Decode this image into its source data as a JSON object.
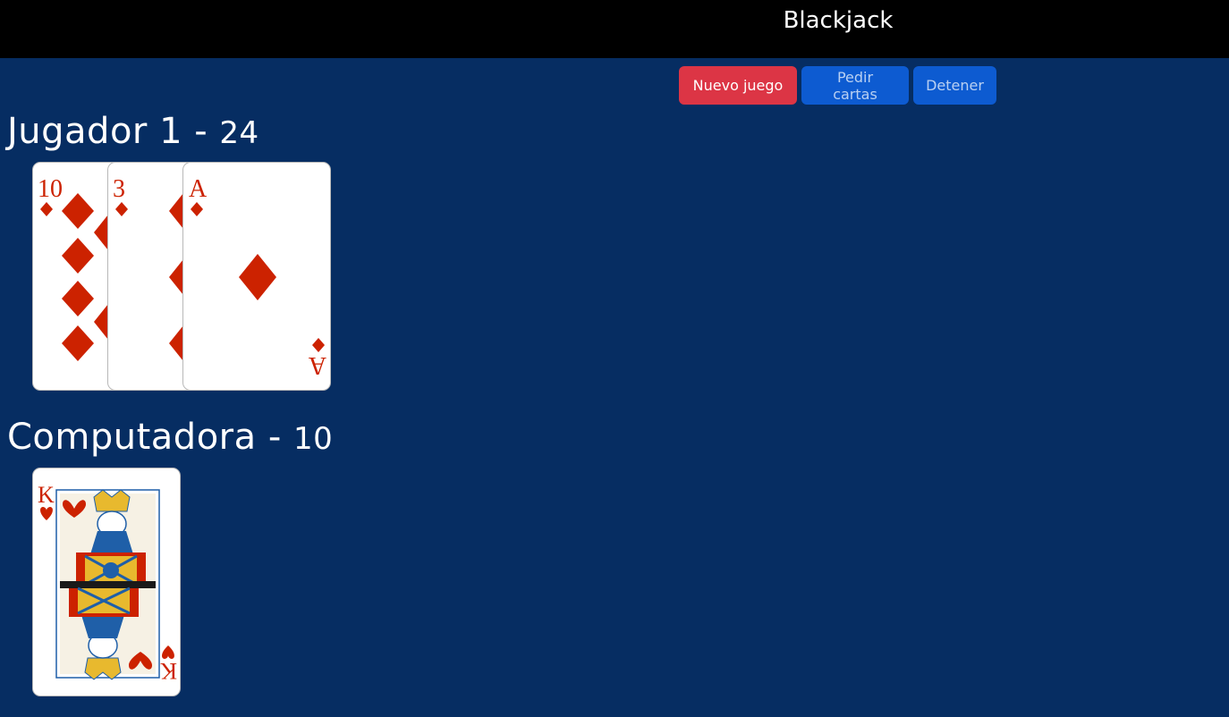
{
  "header": {
    "title": "Blackjack"
  },
  "controls": {
    "new_game": "Nuevo juego",
    "hit": "Pedir cartas",
    "stand": "Detener"
  },
  "player": {
    "name": "Jugador 1",
    "separator": "-",
    "score": "24",
    "cards": [
      {
        "rank": "10",
        "suit": "diamonds"
      },
      {
        "rank": "3",
        "suit": "diamonds"
      },
      {
        "rank": "A",
        "suit": "diamonds"
      }
    ]
  },
  "computer": {
    "name": "Computadora",
    "separator": "-",
    "score": "10",
    "cards": [
      {
        "rank": "K",
        "suit": "hearts"
      }
    ]
  },
  "colors": {
    "background": "#062d62",
    "topbar": "#000000",
    "new_game_button": "#dc3545",
    "action_button": "#0d5bd1",
    "card_red": "#cc2200"
  }
}
